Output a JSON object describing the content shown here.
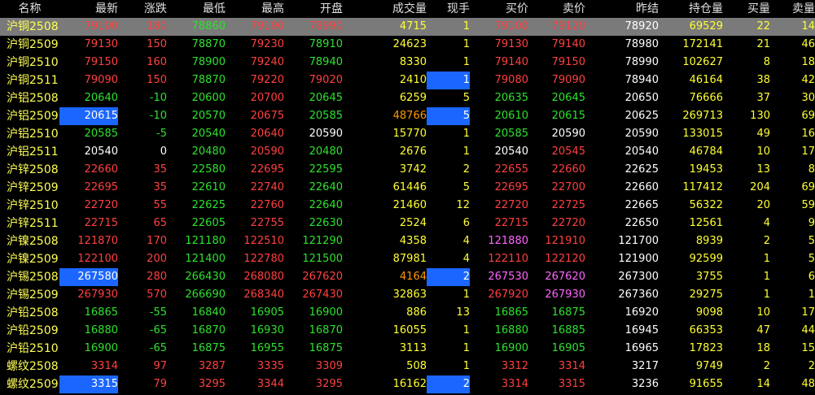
{
  "colors": {
    "up": "#ff4040",
    "down": "#2ee12e",
    "flat": "#ffffff",
    "volume": "#ffff33",
    "ask_special": "#ff66ff",
    "highlight_row": "#7a7a7a",
    "flash": "#1a66ff"
  },
  "headers": [
    "名称",
    "最新",
    "涨跌",
    "最低",
    "最高",
    "开盘",
    "成交量",
    "现手",
    "买价",
    "卖价",
    "昨结",
    "持仓量",
    "买量",
    "卖量"
  ],
  "rows": [
    {
      "name": "沪铜2508",
      "last": "79100",
      "change": "180",
      "low": "78860",
      "high": "79190",
      "open": "78990",
      "volume": "4715",
      "cur": "1",
      "bid": "79100",
      "ask": "79120",
      "prev": "78920",
      "oi": "69529",
      "bidvol": "22",
      "askvol": "14",
      "cls": {
        "last": "c-red",
        "change": "c-red",
        "low": "c-green",
        "high": "c-red",
        "open": "c-red",
        "bid": "c-red",
        "ask": "c-red"
      },
      "selected": true
    },
    {
      "name": "沪铜2509",
      "last": "79130",
      "change": "150",
      "low": "78870",
      "high": "79230",
      "open": "78910",
      "volume": "24623",
      "cur": "1",
      "bid": "79130",
      "ask": "79140",
      "prev": "78980",
      "oi": "172141",
      "bidvol": "21",
      "askvol": "46",
      "cls": {
        "last": "c-red",
        "change": "c-red",
        "low": "c-green",
        "high": "c-red",
        "open": "c-green",
        "bid": "c-red",
        "ask": "c-red"
      }
    },
    {
      "name": "沪铜2510",
      "last": "79150",
      "change": "160",
      "low": "78900",
      "high": "79240",
      "open": "78940",
      "volume": "8330",
      "cur": "1",
      "bid": "79140",
      "ask": "79150",
      "prev": "78990",
      "oi": "102627",
      "bidvol": "8",
      "askvol": "18",
      "cls": {
        "last": "c-red",
        "change": "c-red",
        "low": "c-green",
        "high": "c-red",
        "open": "c-green",
        "bid": "c-red",
        "ask": "c-red"
      }
    },
    {
      "name": "沪铜2511",
      "last": "79090",
      "change": "150",
      "low": "78870",
      "high": "79220",
      "open": "79020",
      "volume": "2410",
      "cur": "1",
      "bid": "79080",
      "ask": "79090",
      "prev": "78940",
      "oi": "46164",
      "bidvol": "38",
      "askvol": "42",
      "cls": {
        "last": "c-red",
        "change": "c-red",
        "low": "c-green",
        "high": "c-red",
        "open": "c-red",
        "bid": "c-red",
        "ask": "c-red"
      },
      "flash": [
        "cur"
      ]
    },
    {
      "name": "沪铝2508",
      "last": "20640",
      "change": "-10",
      "low": "20600",
      "high": "20700",
      "open": "20645",
      "volume": "6259",
      "cur": "5",
      "bid": "20635",
      "ask": "20645",
      "prev": "20650",
      "oi": "76666",
      "bidvol": "37",
      "askvol": "30",
      "cls": {
        "last": "c-green",
        "change": "c-green",
        "low": "c-green",
        "high": "c-red",
        "open": "c-green",
        "bid": "c-green",
        "ask": "c-green"
      }
    },
    {
      "name": "沪铝2509",
      "last": "20615",
      "change": "-10",
      "low": "20570",
      "high": "20675",
      "open": "20585",
      "volume": "48766",
      "cur": "5",
      "bid": "20610",
      "ask": "20615",
      "prev": "20625",
      "oi": "269713",
      "bidvol": "130",
      "askvol": "69",
      "cls": {
        "last": "c-white",
        "change": "c-green",
        "low": "c-green",
        "high": "c-red",
        "open": "c-green",
        "volume": "c-orange",
        "bid": "c-green",
        "ask": "c-green"
      },
      "flash": [
        "last",
        "cur"
      ]
    },
    {
      "name": "沪铝2510",
      "last": "20585",
      "change": "-5",
      "low": "20540",
      "high": "20640",
      "open": "20590",
      "volume": "15770",
      "cur": "1",
      "bid": "20585",
      "ask": "20590",
      "prev": "20590",
      "oi": "133015",
      "bidvol": "49",
      "askvol": "16",
      "cls": {
        "last": "c-green",
        "change": "c-green",
        "low": "c-green",
        "high": "c-red",
        "open": "c-white",
        "bid": "c-green",
        "ask": "c-white"
      }
    },
    {
      "name": "沪铝2511",
      "last": "20540",
      "change": "0",
      "low": "20480",
      "high": "20590",
      "open": "20480",
      "volume": "2676",
      "cur": "1",
      "bid": "20540",
      "ask": "20545",
      "prev": "20540",
      "oi": "46784",
      "bidvol": "10",
      "askvol": "17",
      "cls": {
        "last": "c-white",
        "change": "c-white",
        "low": "c-green",
        "high": "c-red",
        "open": "c-green",
        "bid": "c-white",
        "ask": "c-red"
      }
    },
    {
      "name": "沪锌2508",
      "last": "22660",
      "change": "35",
      "low": "22580",
      "high": "22695",
      "open": "22595",
      "volume": "3742",
      "cur": "2",
      "bid": "22655",
      "ask": "22660",
      "prev": "22625",
      "oi": "19453",
      "bidvol": "13",
      "askvol": "8",
      "cls": {
        "last": "c-red",
        "change": "c-red",
        "low": "c-green",
        "high": "c-red",
        "open": "c-green",
        "bid": "c-red",
        "ask": "c-red"
      }
    },
    {
      "name": "沪锌2509",
      "last": "22695",
      "change": "35",
      "low": "22610",
      "high": "22740",
      "open": "22640",
      "volume": "61446",
      "cur": "5",
      "bid": "22695",
      "ask": "22700",
      "prev": "22660",
      "oi": "117412",
      "bidvol": "204",
      "askvol": "69",
      "cls": {
        "last": "c-red",
        "change": "c-red",
        "low": "c-green",
        "high": "c-red",
        "open": "c-green",
        "bid": "c-red",
        "ask": "c-red"
      }
    },
    {
      "name": "沪锌2510",
      "last": "22720",
      "change": "55",
      "low": "22625",
      "high": "22760",
      "open": "22640",
      "volume": "21460",
      "cur": "12",
      "bid": "22720",
      "ask": "22725",
      "prev": "22665",
      "oi": "56322",
      "bidvol": "20",
      "askvol": "59",
      "cls": {
        "last": "c-red",
        "change": "c-red",
        "low": "c-green",
        "high": "c-red",
        "open": "c-green",
        "bid": "c-red",
        "ask": "c-red"
      }
    },
    {
      "name": "沪锌2511",
      "last": "22715",
      "change": "65",
      "low": "22605",
      "high": "22755",
      "open": "22630",
      "volume": "2524",
      "cur": "6",
      "bid": "22715",
      "ask": "22720",
      "prev": "22650",
      "oi": "12561",
      "bidvol": "4",
      "askvol": "9",
      "cls": {
        "last": "c-red",
        "change": "c-red",
        "low": "c-green",
        "high": "c-red",
        "open": "c-green",
        "bid": "c-red",
        "ask": "c-red"
      }
    },
    {
      "name": "沪镍2508",
      "last": "121870",
      "change": "170",
      "low": "121180",
      "high": "122510",
      "open": "121290",
      "volume": "4358",
      "cur": "4",
      "bid": "121880",
      "ask": "121910",
      "prev": "121700",
      "oi": "8939",
      "bidvol": "2",
      "askvol": "5",
      "cls": {
        "last": "c-red",
        "change": "c-red",
        "low": "c-green",
        "high": "c-red",
        "open": "c-green",
        "bid": "c-magenta",
        "ask": "c-red"
      }
    },
    {
      "name": "沪镍2509",
      "last": "122100",
      "change": "200",
      "low": "121400",
      "high": "122780",
      "open": "121500",
      "volume": "87981",
      "cur": "4",
      "bid": "122110",
      "ask": "122120",
      "prev": "121900",
      "oi": "92599",
      "bidvol": "1",
      "askvol": "5",
      "cls": {
        "last": "c-red",
        "change": "c-red",
        "low": "c-green",
        "high": "c-red",
        "open": "c-green",
        "bid": "c-red",
        "ask": "c-red"
      }
    },
    {
      "name": "沪锡2508",
      "last": "267580",
      "change": "280",
      "low": "266430",
      "high": "268080",
      "open": "267620",
      "volume": "4164",
      "cur": "2",
      "bid": "267530",
      "ask": "267620",
      "prev": "267300",
      "oi": "3755",
      "bidvol": "1",
      "askvol": "6",
      "cls": {
        "last": "c-white",
        "change": "c-red",
        "low": "c-green",
        "high": "c-red",
        "open": "c-red",
        "volume": "c-orange",
        "bid": "c-magenta",
        "ask": "c-magenta"
      },
      "flash": [
        "last",
        "cur"
      ]
    },
    {
      "name": "沪锡2509",
      "last": "267930",
      "change": "570",
      "low": "266690",
      "high": "268340",
      "open": "267430",
      "volume": "32863",
      "cur": "1",
      "bid": "267920",
      "ask": "267930",
      "prev": "267360",
      "oi": "29275",
      "bidvol": "1",
      "askvol": "1",
      "cls": {
        "last": "c-red",
        "change": "c-red",
        "low": "c-green",
        "high": "c-red",
        "open": "c-red",
        "bid": "c-red",
        "ask": "c-magenta"
      }
    },
    {
      "name": "沪铅2508",
      "last": "16865",
      "change": "-55",
      "low": "16840",
      "high": "16905",
      "open": "16900",
      "volume": "886",
      "cur": "13",
      "bid": "16865",
      "ask": "16875",
      "prev": "16920",
      "oi": "9098",
      "bidvol": "10",
      "askvol": "17",
      "cls": {
        "last": "c-green",
        "change": "c-green",
        "low": "c-green",
        "high": "c-green",
        "open": "c-green",
        "bid": "c-green",
        "ask": "c-green"
      }
    },
    {
      "name": "沪铅2509",
      "last": "16880",
      "change": "-65",
      "low": "16870",
      "high": "16930",
      "open": "16870",
      "volume": "16055",
      "cur": "1",
      "bid": "16880",
      "ask": "16885",
      "prev": "16945",
      "oi": "66353",
      "bidvol": "47",
      "askvol": "44",
      "cls": {
        "last": "c-green",
        "change": "c-green",
        "low": "c-green",
        "high": "c-green",
        "open": "c-green",
        "bid": "c-green",
        "ask": "c-green"
      }
    },
    {
      "name": "沪铅2510",
      "last": "16900",
      "change": "-65",
      "low": "16875",
      "high": "16955",
      "open": "16875",
      "volume": "3113",
      "cur": "1",
      "bid": "16900",
      "ask": "16905",
      "prev": "16965",
      "oi": "17823",
      "bidvol": "18",
      "askvol": "15",
      "cls": {
        "last": "c-green",
        "change": "c-green",
        "low": "c-green",
        "high": "c-green",
        "open": "c-green",
        "bid": "c-green",
        "ask": "c-green"
      }
    },
    {
      "name": "螺纹2508",
      "last": "3314",
      "change": "97",
      "low": "3287",
      "high": "3335",
      "open": "3309",
      "volume": "508",
      "cur": "1",
      "bid": "3312",
      "ask": "3314",
      "prev": "3217",
      "oi": "9749",
      "bidvol": "2",
      "askvol": "2",
      "cls": {
        "last": "c-red",
        "change": "c-red",
        "low": "c-red",
        "high": "c-red",
        "open": "c-red",
        "bid": "c-red",
        "ask": "c-red"
      }
    },
    {
      "name": "螺纹2509",
      "last": "3315",
      "change": "79",
      "low": "3295",
      "high": "3344",
      "open": "3295",
      "volume": "16162",
      "cur": "2",
      "bid": "3314",
      "ask": "3315",
      "prev": "3236",
      "oi": "91655",
      "bidvol": "14",
      "askvol": "48",
      "cls": {
        "last": "c-white",
        "change": "c-red",
        "low": "c-red",
        "high": "c-red",
        "open": "c-red",
        "bid": "c-red",
        "ask": "c-red"
      },
      "flash": [
        "last",
        "cur"
      ]
    }
  ]
}
